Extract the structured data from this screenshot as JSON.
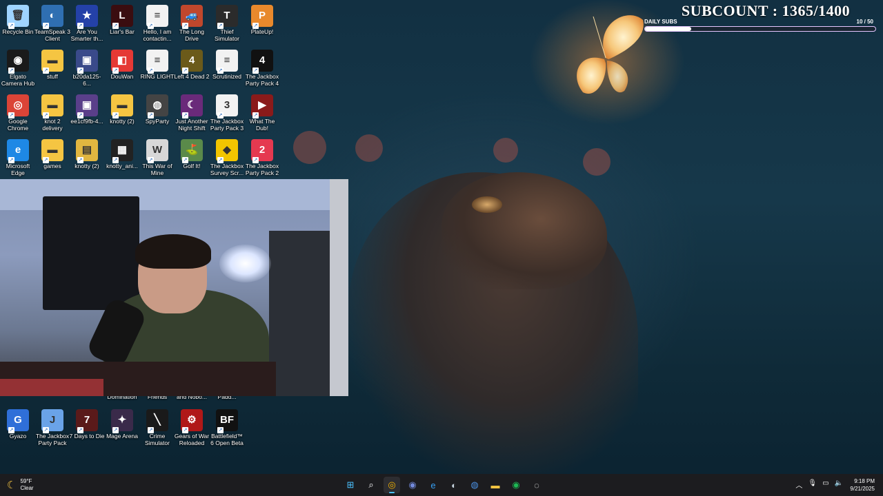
{
  "desktop_icons": [
    {
      "label": "Recycle Bin",
      "icon": "recycle-bin-icon",
      "color": "#9fd4ff",
      "glyph": "🗑"
    },
    {
      "label": "TeamSpeak 3 Client",
      "icon": "teamspeak-icon",
      "color": "#2f6fb2",
      "glyph": "◐"
    },
    {
      "label": "Are You Smarter th...",
      "icon": "smarter-game-icon",
      "color": "#2441a8",
      "glyph": "★"
    },
    {
      "label": "Liar's Bar",
      "icon": "liars-bar-icon",
      "color": "#3a0d10",
      "glyph": "L"
    },
    {
      "label": "Hello, I am contactin...",
      "icon": "document-icon",
      "color": "#f2f2f2",
      "glyph": "≡"
    },
    {
      "label": "The Long Drive",
      "icon": "long-drive-icon",
      "color": "#c0472c",
      "glyph": "🚙"
    },
    {
      "label": "Thief Simulator",
      "icon": "thief-simulator-icon",
      "color": "#2b2b2b",
      "glyph": "T"
    },
    {
      "label": "PlateUp!",
      "icon": "plateup-icon",
      "color": "#e8892c",
      "glyph": "P"
    },
    {
      "label": "Elgato Camera Hub",
      "icon": "elgato-icon",
      "color": "#1a1a1a",
      "glyph": "◉"
    },
    {
      "label": "stuff",
      "icon": "folder-icon",
      "color": "#f5c542",
      "glyph": "▬"
    },
    {
      "label": "b20da125-6...",
      "icon": "image-file-icon",
      "color": "#3a4a8a",
      "glyph": "▣"
    },
    {
      "label": "DouWan",
      "icon": "douwan-icon",
      "color": "#e53935",
      "glyph": "◧"
    },
    {
      "label": "RING LIGHT",
      "icon": "document-icon",
      "color": "#f2f2f2",
      "glyph": "≡"
    },
    {
      "label": "Left 4 Dead 2",
      "icon": "left4dead-icon",
      "color": "#6b5a1a",
      "glyph": "4"
    },
    {
      "label": "Scrutinized",
      "icon": "document-icon",
      "color": "#f2f2f2",
      "glyph": "≡"
    },
    {
      "label": "The Jackbox Party Pack 4",
      "icon": "jackbox4-icon",
      "color": "#111111",
      "glyph": "4"
    },
    {
      "label": "Google Chrome",
      "icon": "chrome-icon",
      "color": "#db4437",
      "glyph": "◎"
    },
    {
      "label": "knot 2 delivery",
      "icon": "folder-icon",
      "color": "#f5c542",
      "glyph": "▬"
    },
    {
      "label": "ee1cf9fb-4...",
      "icon": "image-file-icon",
      "color": "#5a3f8a",
      "glyph": "▣"
    },
    {
      "label": "knotty (2)",
      "icon": "folder-icon",
      "color": "#f5c542",
      "glyph": "▬"
    },
    {
      "label": "SpyParty",
      "icon": "spyparty-icon",
      "color": "#444444",
      "glyph": "◍"
    },
    {
      "label": "Just Another Night Shift",
      "icon": "night-shift-icon",
      "color": "#6a2a7a",
      "glyph": "☾"
    },
    {
      "label": "The Jackbox Party Pack 3",
      "icon": "jackbox3-icon",
      "color": "#f2f2f2",
      "glyph": "3"
    },
    {
      "label": "What The Dub!",
      "icon": "what-the-dub-icon",
      "color": "#8a1a1a",
      "glyph": "▶"
    },
    {
      "label": "Microsoft Edge",
      "icon": "edge-icon",
      "color": "#1e88e5",
      "glyph": "e"
    },
    {
      "label": "games",
      "icon": "folder-icon",
      "color": "#f5c542",
      "glyph": "▬"
    },
    {
      "label": "knotty (2)",
      "icon": "zip-folder-icon",
      "color": "#e0b640",
      "glyph": "▤"
    },
    {
      "label": "knotty_ani...",
      "icon": "video-file-icon",
      "color": "#222222",
      "glyph": "▦"
    },
    {
      "label": "This War of Mine",
      "icon": "this-war-of-mine-icon",
      "color": "#d8d8d8",
      "glyph": "W"
    },
    {
      "label": "Golf It!",
      "icon": "golf-it-icon",
      "color": "#5a8a4a",
      "glyph": "⛳"
    },
    {
      "label": "The Jackbox Survey Scr...",
      "icon": "jackbox-survey-icon",
      "color": "#f2c500",
      "glyph": "◆"
    },
    {
      "label": "The Jackbox Party Pack 2",
      "icon": "jackbox2-icon",
      "color": "#e53950",
      "glyph": "2"
    },
    {
      "label": "Gyazo",
      "icon": "gyazo-icon",
      "color": "#2f6fd8",
      "glyph": "G"
    },
    {
      "label": "The Jackbox Party Pack",
      "icon": "jackbox1-icon",
      "color": "#6aa3e8",
      "glyph": "J"
    },
    {
      "label": "7 Days to Die",
      "icon": "seven-days-icon",
      "color": "#5a1a1a",
      "glyph": "7"
    },
    {
      "label": "Mage Arena",
      "icon": "mage-arena-icon",
      "color": "#3a2a4a",
      "glyph": "✦"
    },
    {
      "label": "Crime Simulator",
      "icon": "crime-simulator-icon",
      "color": "#1a1a1a",
      "glyph": "╲"
    },
    {
      "label": "Gears of War Reloaded",
      "icon": "gears-of-war-icon",
      "color": "#b01818",
      "glyph": "⚙"
    },
    {
      "label": "Battlefield™ 6 Open Beta",
      "icon": "battlefield-icon",
      "color": "#111111",
      "glyph": "BF"
    }
  ],
  "partial_labels": [
    "Domination",
    "Friends",
    "and Nobo...",
    "Padd..."
  ],
  "subcount": {
    "title": "SUBCOUNT : 1365/1400",
    "daily_label": "DAILY SUBS",
    "daily_count": "10  / 50",
    "daily_progress": 0.2
  },
  "taskbar": {
    "weather_temp": "59°F",
    "weather_cond": "Clear",
    "time": "9:18 PM",
    "date": "9/21/2025",
    "apps": [
      {
        "name": "start-button",
        "glyph": "⊞",
        "color": "#4cc2ff",
        "active": false
      },
      {
        "name": "search-button",
        "glyph": "⌕",
        "color": "#ffffff",
        "active": false
      },
      {
        "name": "taskbar-chrome",
        "glyph": "◎",
        "color": "#f4b400",
        "active": true
      },
      {
        "name": "taskbar-discord",
        "glyph": "◉",
        "color": "#7289da",
        "active": false
      },
      {
        "name": "taskbar-edge",
        "glyph": "e",
        "color": "#37a0f4",
        "active": false
      },
      {
        "name": "taskbar-steam",
        "glyph": "◐",
        "color": "#c7d5e0",
        "active": false
      },
      {
        "name": "taskbar-app",
        "glyph": "◍",
        "color": "#4a90e2",
        "active": false
      },
      {
        "name": "taskbar-file-explorer",
        "glyph": "▬",
        "color": "#f5c542",
        "active": false
      },
      {
        "name": "taskbar-spotify",
        "glyph": "◉",
        "color": "#1db954",
        "active": false
      },
      {
        "name": "taskbar-streaming-app",
        "glyph": "◌",
        "color": "#ffffff",
        "active": false
      }
    ]
  }
}
